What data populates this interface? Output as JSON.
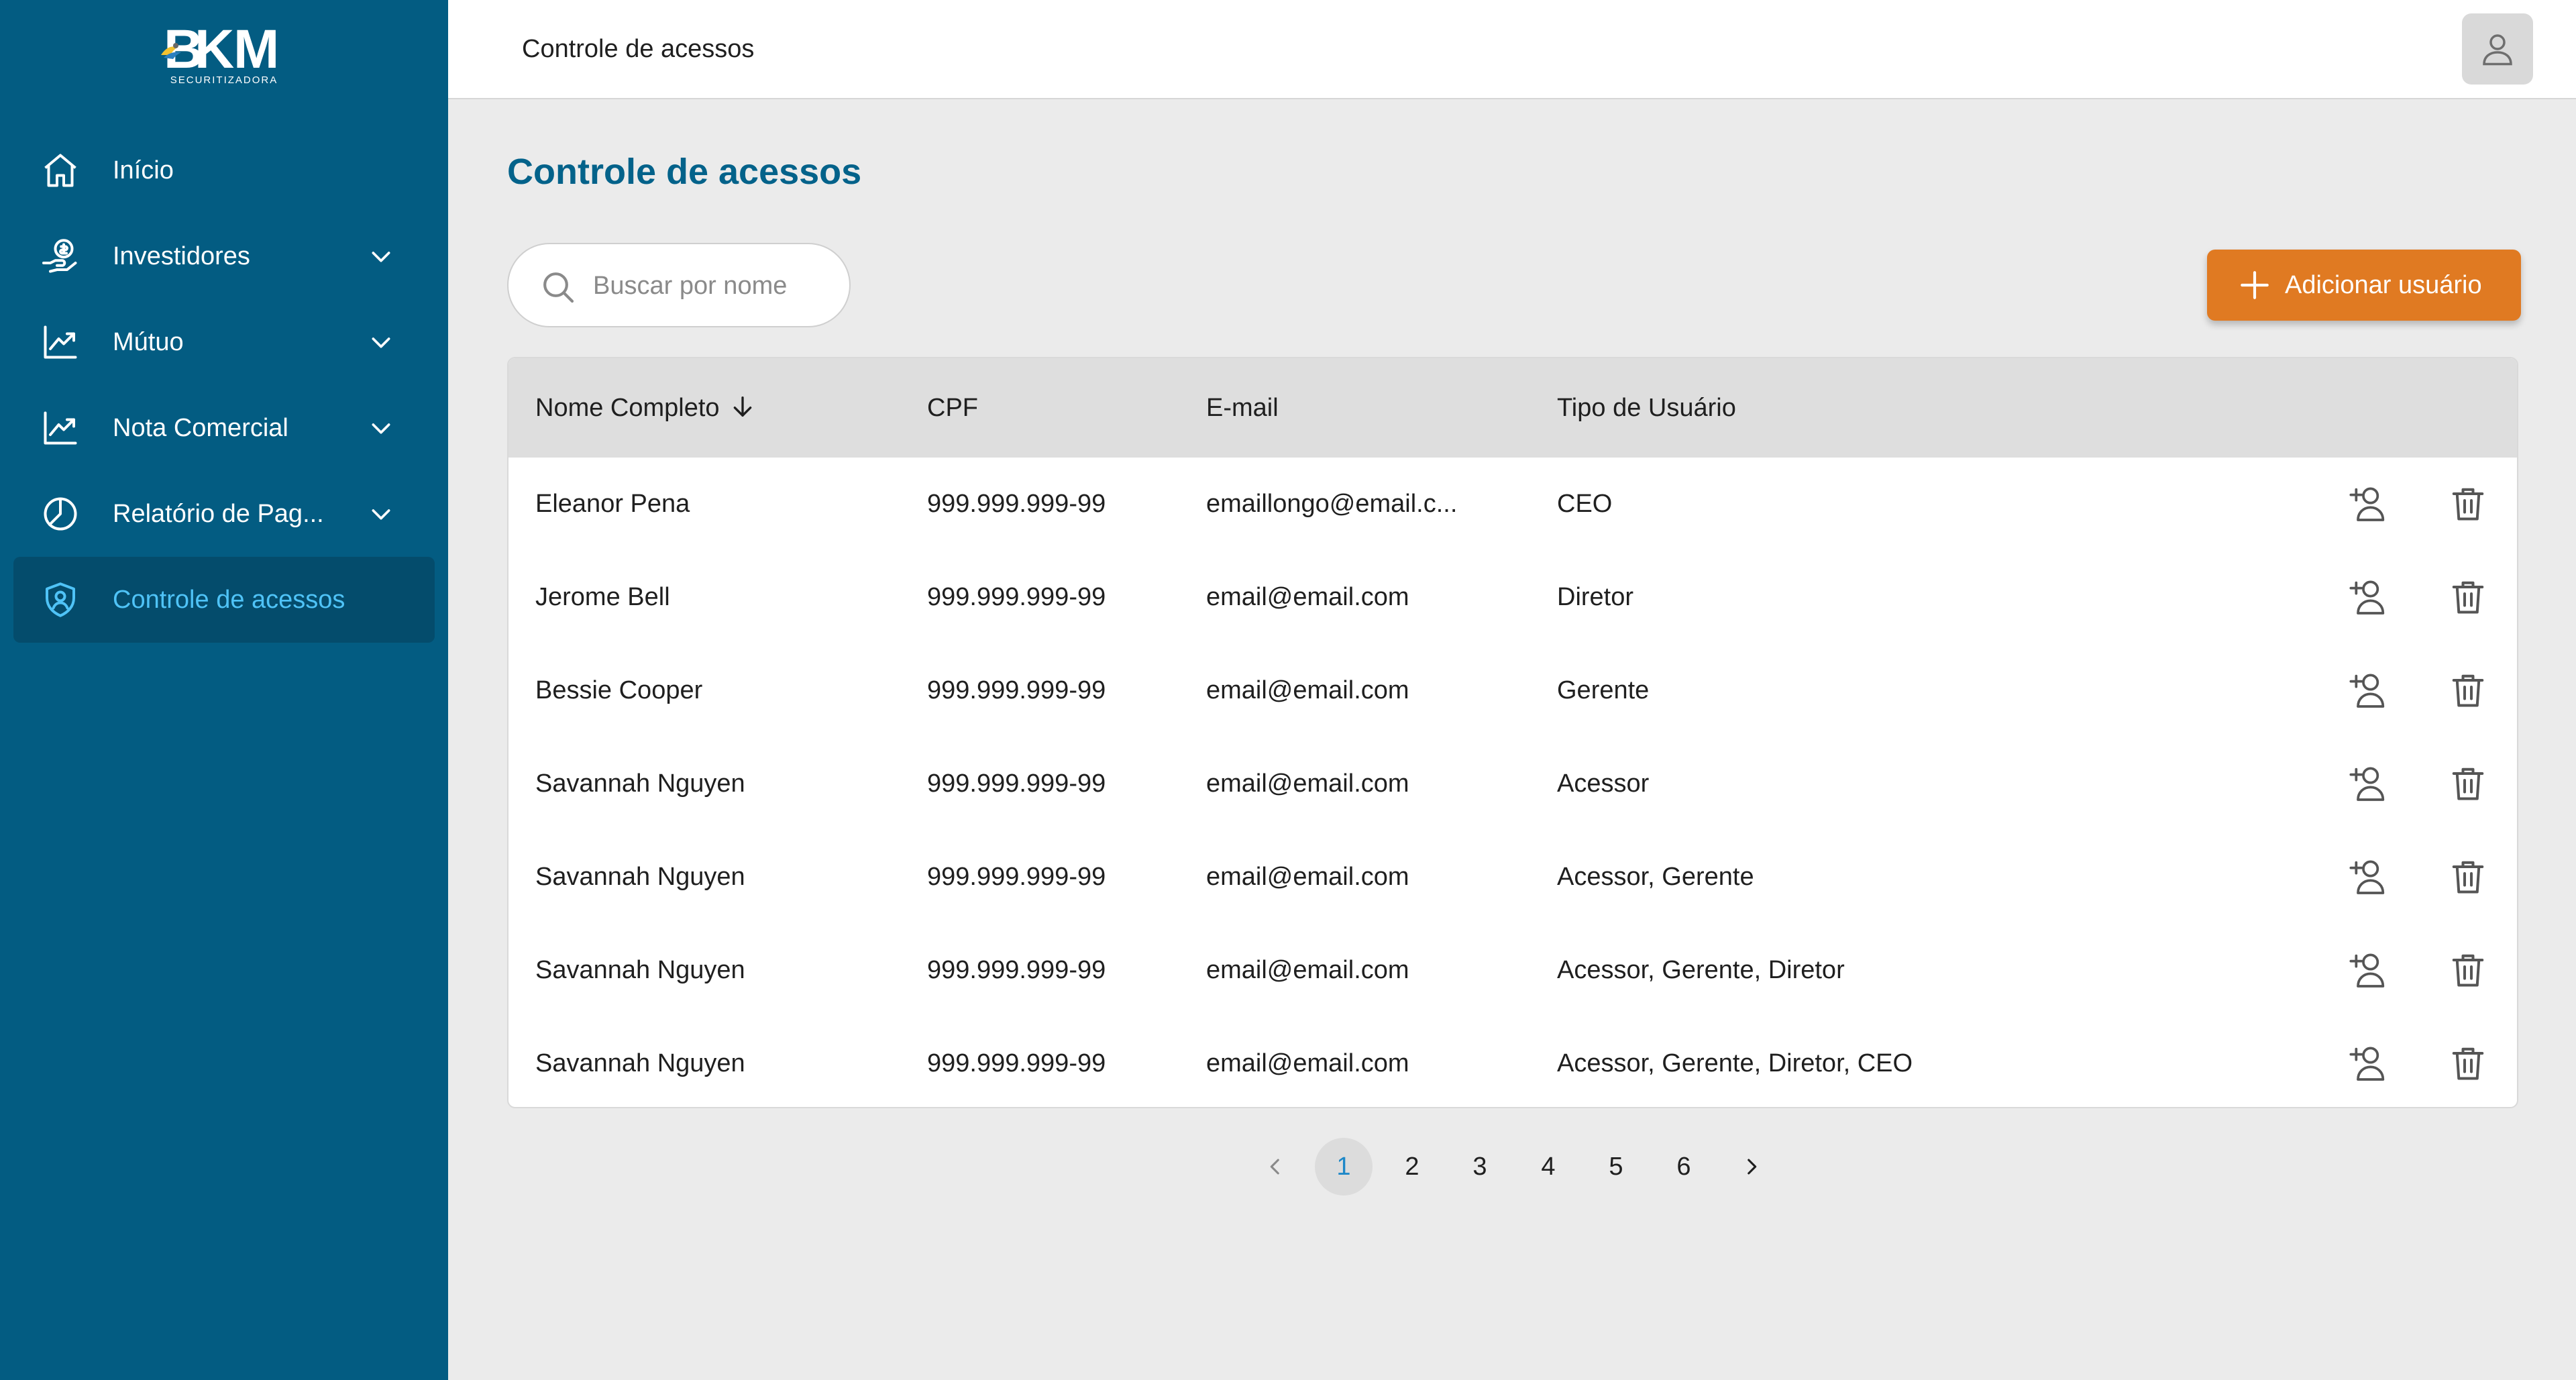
{
  "brand": {
    "logo_text_b": "B",
    "logo_text_k": "K",
    "logo_text_m": "M",
    "logo_sub": "SECURITIZADORA"
  },
  "sidebar": {
    "items": [
      {
        "label": "Início",
        "icon": "home-icon",
        "expandable": false
      },
      {
        "label": "Investidores",
        "icon": "money-hand-icon",
        "expandable": true
      },
      {
        "label": "Mútuo",
        "icon": "chart-line-icon",
        "expandable": true
      },
      {
        "label": "Nota Comercial",
        "icon": "chart-line-icon",
        "expandable": true
      },
      {
        "label": "Relatório de Pag...",
        "icon": "pie-chart-icon",
        "expandable": true
      },
      {
        "label": "Controle de acessos",
        "icon": "shield-user-icon",
        "expandable": false,
        "active": true
      }
    ]
  },
  "topbar": {
    "title": "Controle de acessos",
    "avatar_icon": "user-icon"
  },
  "main": {
    "title": "Controle de acessos",
    "search": {
      "placeholder": "Buscar por nome",
      "value": ""
    },
    "add_button_label": "Adicionar usuário"
  },
  "table": {
    "columns": [
      "Nome Completo",
      "CPF",
      "E-mail",
      "Tipo de Usuário"
    ],
    "sort": {
      "column": "Nome Completo",
      "direction": "desc"
    },
    "rows": [
      {
        "name": "Eleanor Pena",
        "cpf": "999.999.999-99",
        "email": "emaillongo@email.c...",
        "type": "CEO"
      },
      {
        "name": "Jerome Bell",
        "cpf": "999.999.999-99",
        "email": "email@email.com",
        "type": "Diretor"
      },
      {
        "name": "Bessie Cooper",
        "cpf": "999.999.999-99",
        "email": "email@email.com",
        "type": "Gerente"
      },
      {
        "name": "Savannah Nguyen",
        "cpf": "999.999.999-99",
        "email": "email@email.com",
        "type": "Acessor"
      },
      {
        "name": "Savannah Nguyen",
        "cpf": "999.999.999-99",
        "email": "email@email.com",
        "type": "Acessor, Gerente"
      },
      {
        "name": "Savannah Nguyen",
        "cpf": "999.999.999-99",
        "email": "email@email.com",
        "type": "Acessor, Gerente, Diretor"
      },
      {
        "name": "Savannah Nguyen",
        "cpf": "999.999.999-99",
        "email": "email@email.com",
        "type": "Acessor, Gerente, Diretor, CEO"
      }
    ],
    "row_actions": [
      "user-edit-icon",
      "trash-icon"
    ]
  },
  "pagination": {
    "pages": [
      "1",
      "2",
      "3",
      "4",
      "5",
      "6"
    ],
    "current": "1"
  },
  "colors": {
    "sidebar": "#035c82",
    "sidebar_active": "#044c6c",
    "active_text": "#4fc3f7",
    "title": "#03628a",
    "accent": "#e07a22",
    "page_active": "#1e88c8"
  }
}
